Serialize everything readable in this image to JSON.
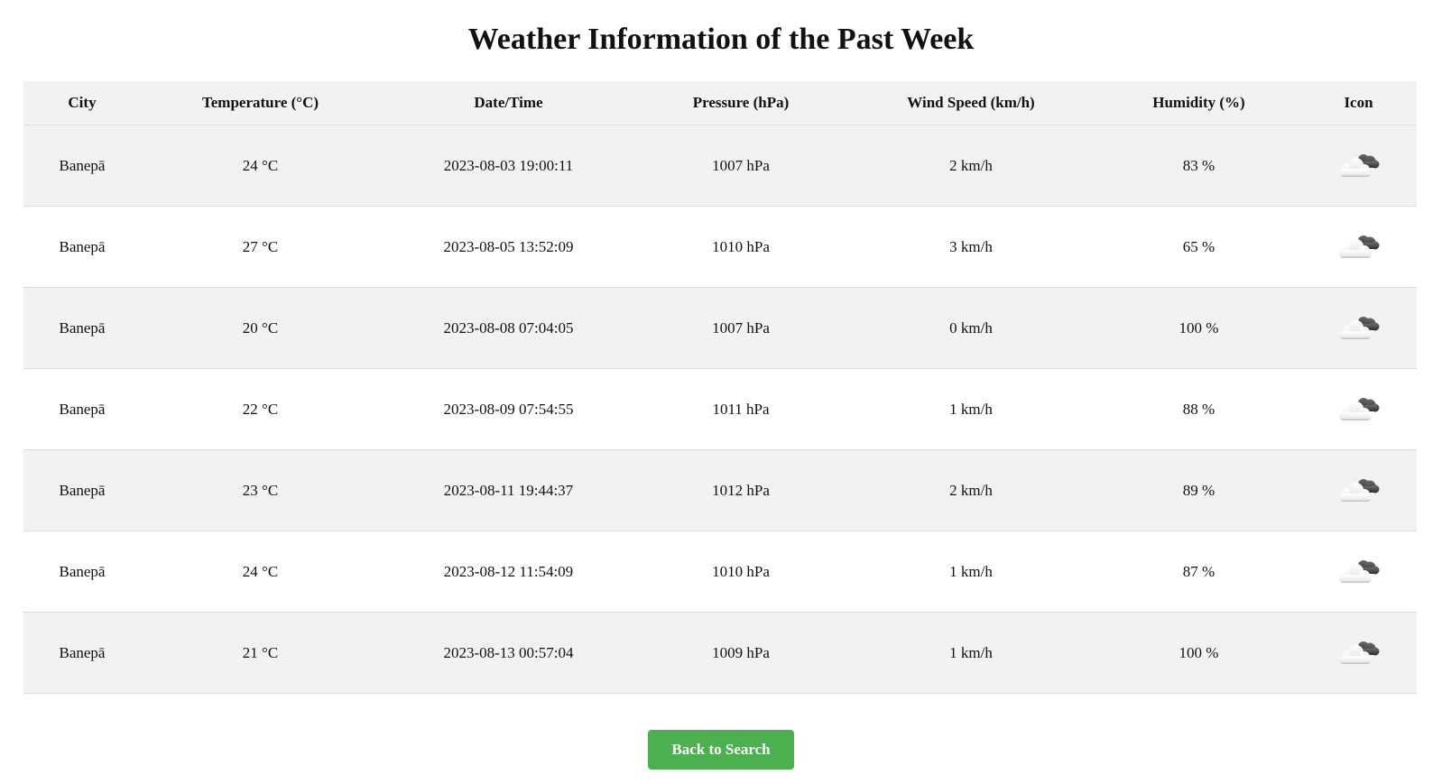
{
  "page": {
    "title": "Weather Information of the Past Week"
  },
  "table": {
    "headers": {
      "city": "City",
      "temperature": "Temperature (°C)",
      "datetime": "Date/Time",
      "pressure": "Pressure (hPa)",
      "wind": "Wind Speed (km/h)",
      "humidity": "Humidity (%)",
      "icon": "Icon"
    },
    "rows": [
      {
        "city": "Banepā",
        "temperature": "24 °C",
        "datetime": "2023-08-03 19:00:11",
        "pressure": "1007 hPa",
        "wind": "2 km/h",
        "humidity": "83 %",
        "icon": "partly-cloudy-icon"
      },
      {
        "city": "Banepā",
        "temperature": "27 °C",
        "datetime": "2023-08-05 13:52:09",
        "pressure": "1010 hPa",
        "wind": "3 km/h",
        "humidity": "65 %",
        "icon": "partly-cloudy-icon"
      },
      {
        "city": "Banepā",
        "temperature": "20 °C",
        "datetime": "2023-08-08 07:04:05",
        "pressure": "1007 hPa",
        "wind": "0 km/h",
        "humidity": "100 %",
        "icon": "partly-cloudy-icon"
      },
      {
        "city": "Banepā",
        "temperature": "22 °C",
        "datetime": "2023-08-09 07:54:55",
        "pressure": "1011 hPa",
        "wind": "1 km/h",
        "humidity": "88 %",
        "icon": "partly-cloudy-icon"
      },
      {
        "city": "Banepā",
        "temperature": "23 °C",
        "datetime": "2023-08-11 19:44:37",
        "pressure": "1012 hPa",
        "wind": "2 km/h",
        "humidity": "89 %",
        "icon": "partly-cloudy-icon"
      },
      {
        "city": "Banepā",
        "temperature": "24 °C",
        "datetime": "2023-08-12 11:54:09",
        "pressure": "1010 hPa",
        "wind": "1 km/h",
        "humidity": "87 %",
        "icon": "partly-cloudy-icon"
      },
      {
        "city": "Banepā",
        "temperature": "21 °C",
        "datetime": "2023-08-13 00:57:04",
        "pressure": "1009 hPa",
        "wind": "1 km/h",
        "humidity": "100 %",
        "icon": "partly-cloudy-icon"
      }
    ]
  },
  "actions": {
    "back_label": "Back to Search"
  },
  "colors": {
    "button_bg": "#4caf50",
    "header_bg": "#f2f2f2",
    "stripe_bg": "#f2f2f2",
    "border": "#dddddd"
  }
}
